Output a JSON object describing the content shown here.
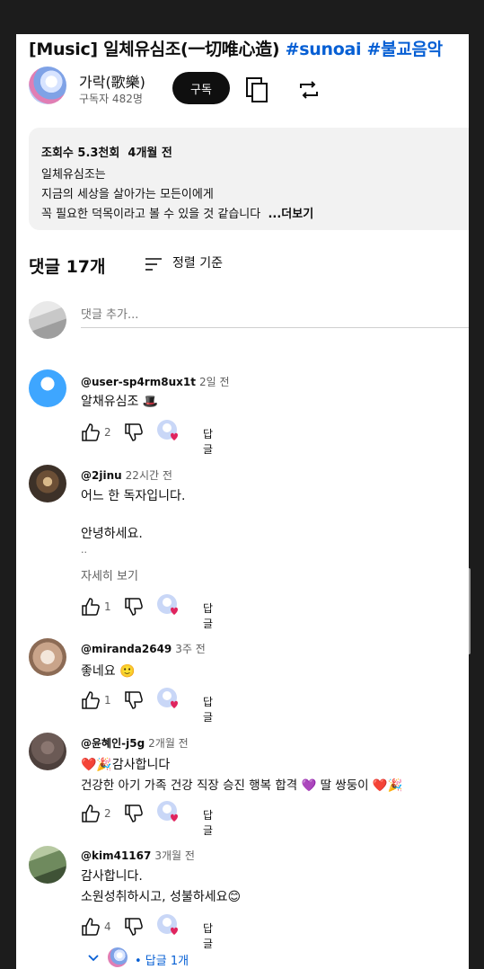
{
  "video": {
    "title": "[Music] 일체유심조(一切唯心造)",
    "hashtags": [
      "#sunoai",
      "#불교음악"
    ]
  },
  "channel": {
    "name": "가락(歌樂)",
    "subscribers": "구독자 482명",
    "subscribe_label": "구독"
  },
  "description": {
    "views": "조회수 5.3천회",
    "age": "4개월 전",
    "lines": [
      "일체유심조는",
      "지금의 세상을 살아가는 모든이에게",
      "꼭 필요한 덕목이라고 볼 수 있을 것 같습니다"
    ],
    "more_label": "...더보기"
  },
  "comments_section": {
    "count_label": "댓글 17개",
    "sort_label": "정렬 기준",
    "add_placeholder": "댓글 추가..."
  },
  "comments": [
    {
      "handle": "@user-sp4rm8ux1t",
      "time": "2일 전",
      "lines": [
        "알채유심조 🎩"
      ],
      "likes": "2",
      "reply_label": "답글",
      "avatar_color": "#3ea6ff"
    },
    {
      "handle": "@2jinu",
      "time": "22시간 전",
      "lines": [
        "어느 한 독자입니다.",
        "",
        "안녕하세요.",
        ".."
      ],
      "see_more": "자세히 보기",
      "likes": "1",
      "reply_label": "답글",
      "avatar_color": "#5b4a3a"
    },
    {
      "handle": "@miranda2649",
      "time": "3주 전",
      "lines": [
        "좋네요 🙂"
      ],
      "likes": "1",
      "reply_label": "답글",
      "avatar_color": "#c9a48a"
    },
    {
      "handle": "@윤혜인-j5g",
      "time": "2개월 전",
      "lines": [
        "❤️🎉감사합니다",
        "건강한 아기 가족 건강 직장 승진 행복 합격 💜 딸 쌍둥이 ❤️🎉"
      ],
      "likes": "2",
      "reply_label": "답글",
      "avatar_color": "#6b5a55"
    },
    {
      "handle": "@kim41167",
      "time": "3개월 전",
      "lines": [
        "감사합니다.",
        "소원성취하시고, 성불하세요😊"
      ],
      "likes": "4",
      "reply_label": "답글",
      "avatar_color": "#6f8a5e"
    }
  ],
  "replies_toggle": {
    "label": "• 답글 1개"
  },
  "colors": {
    "accent_link": "#065fd4",
    "subscribe_bg": "#0f0f0f",
    "description_bg": "#f2f2f2"
  }
}
